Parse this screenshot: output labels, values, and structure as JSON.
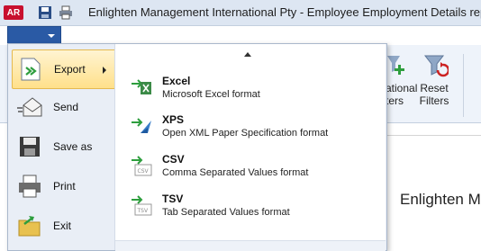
{
  "window": {
    "app_badge": "AR",
    "title": "Enlighten Management International Pty  - Employee Employment Details report"
  },
  "ribbon": {
    "buttons": [
      {
        "label_line1": "ational",
        "label_line2": "ters",
        "icon": "add-filter-icon"
      },
      {
        "label_line1": "Reset",
        "label_line2": "Filters",
        "icon": "reset-filters-icon"
      }
    ]
  },
  "report": {
    "heading_partial": "Enlighten M"
  },
  "menu": {
    "commands": [
      {
        "label": "Export",
        "icon": "export-icon",
        "active": true
      },
      {
        "label": "Send",
        "icon": "send-email-icon"
      },
      {
        "label": "Save as",
        "icon": "save-disk-icon"
      },
      {
        "label": "Print",
        "icon": "printer-icon"
      },
      {
        "label": "Exit",
        "icon": "exit-folder-icon"
      }
    ],
    "export_formats": [
      {
        "name": "Excel",
        "description": "Microsoft Excel format",
        "icon": "excel-export-icon"
      },
      {
        "name": "XPS",
        "description": "Open XML Paper Specification format",
        "icon": "xps-export-icon"
      },
      {
        "name": "CSV",
        "description": "Comma Separated Values format",
        "icon": "csv-export-icon"
      },
      {
        "name": "TSV",
        "description": "Tab Separated Values format",
        "icon": "tsv-export-icon"
      }
    ]
  },
  "colors": {
    "file_tab": "#2a5aa5",
    "active_highlight": "#ffe08a",
    "accent_green": "#2e9e3e"
  }
}
